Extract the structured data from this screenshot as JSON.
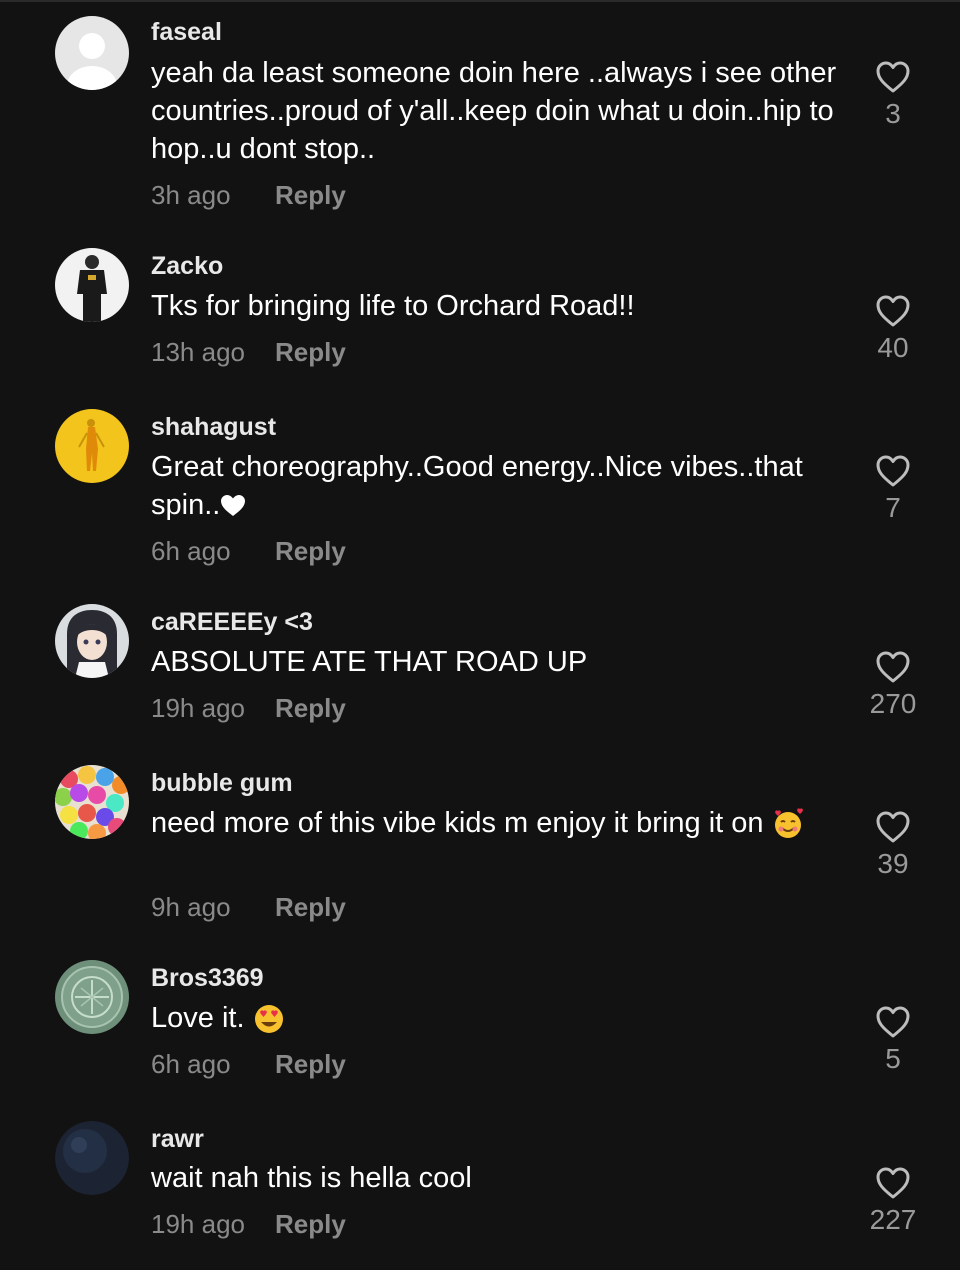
{
  "comments": [
    {
      "username": "faseal",
      "text": "yeah da least someone doin here ..always i see other countries..proud of y'all..keep doin what u doin..hip to hop..u dont stop..",
      "time": "3h ago",
      "reply": "Reply",
      "likes": "3",
      "avatar": "default-avatar-icon"
    },
    {
      "username": "Zacko",
      "text": "Tks for bringing life to Orchard Road!!",
      "time": "13h ago",
      "reply": "Reply",
      "likes": "40",
      "avatar": "person-photo"
    },
    {
      "username": "shahagust",
      "text": "Great choreography..Good energy..Nice vibes..that spin..",
      "text_suffix_emoji": "white-heart-emoji",
      "time": "6h ago",
      "reply": "Reply",
      "likes": "7",
      "avatar": "yellow-figure"
    },
    {
      "username": "caREEEEy <3",
      "text": "ABSOLUTE ATE THAT ROAD UP",
      "time": "19h ago",
      "reply": "Reply",
      "likes": "270",
      "avatar": "anime-character"
    },
    {
      "username": "bubble gum",
      "text": "need more of this vibe kids m enjoy it bring it on",
      "text_suffix_emoji": "smiling-face-with-hearts-emoji",
      "time": "9h ago",
      "reply": "Reply",
      "likes": "39",
      "avatar": "gumballs"
    },
    {
      "username": "Bros3369",
      "text": "Love it.",
      "text_suffix_emoji": "heart-eyes-emoji",
      "time": "6h ago",
      "reply": "Reply",
      "likes": "5",
      "avatar": "green-emblem"
    },
    {
      "username": "rawr",
      "text": "wait nah this is hella cool",
      "time": "19h ago",
      "reply": "Reply",
      "likes": "227",
      "avatar": "dark-sphere"
    }
  ],
  "colors": {
    "background": "#121212",
    "username": "#e8e8e8",
    "text": "#ffffff",
    "meta": "#8a8a8a",
    "like_count": "#9a9a9a"
  }
}
